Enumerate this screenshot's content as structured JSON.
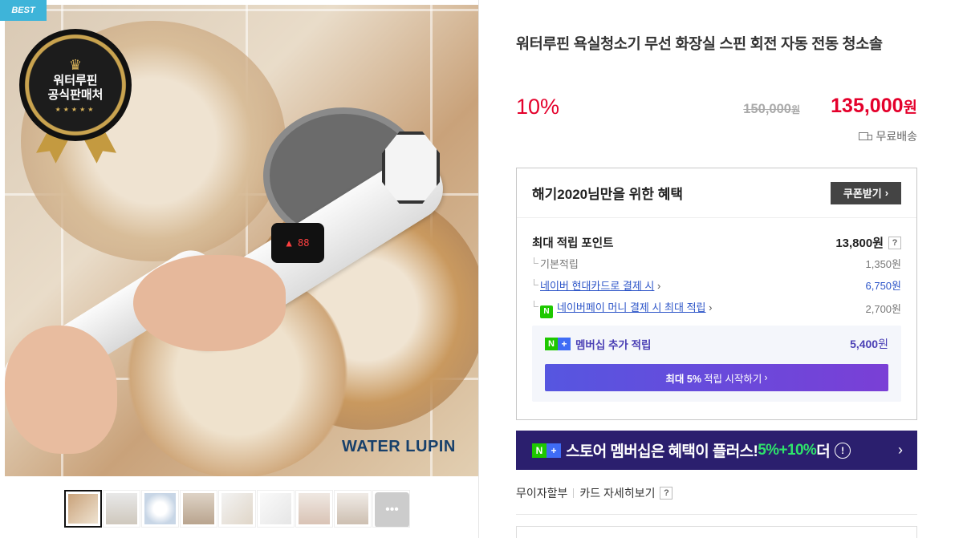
{
  "image": {
    "best_tag": "BEST",
    "badge_text_line1": "워터루핀",
    "badge_text_line2": "공식판매처",
    "brand_watermark": "WATER LUPIN",
    "thumbnail_count": 9
  },
  "product": {
    "title": "워터루핀 욕실청소기 무선 화장실 스핀 회전 자동 전동 청소솔",
    "discount": "10%",
    "original_price": "150,000",
    "original_unit": "원",
    "sale_price": "135,000",
    "sale_unit": "원",
    "shipping": "무료배송"
  },
  "benefits": {
    "title": "해기2020님만을 위한 혜택",
    "coupon_button": "쿠폰받기",
    "max_points_label": "최대 적립 포인트",
    "max_points_value": "13,800원",
    "rows": [
      {
        "label": "기본적립",
        "value": "1,350원"
      },
      {
        "label": "네이버 현대카드로 결제 시",
        "value": "6,750원"
      },
      {
        "label": "네이버페이 머니 결제 시 최대 적립",
        "value": "2,700원"
      }
    ],
    "membership": {
      "label": "멤버십 추가 적립",
      "value": "5,400",
      "unit": "원",
      "button_bold": "최대 5%",
      "button_rest": "적립 시작하기"
    }
  },
  "plus_banner": {
    "text_before": "스토어 멤버십은 혜택이 플러스!",
    "text_green": "5%+10%",
    "text_after": "더"
  },
  "installment": {
    "label": "무이자할부",
    "card_detail": "카드 자세히보기"
  },
  "colors": {
    "accent_red": "#e4002b",
    "naver_green": "#1ec800",
    "membership_purple": "#4a3fb5",
    "banner_bg": "#2b1f6e"
  }
}
